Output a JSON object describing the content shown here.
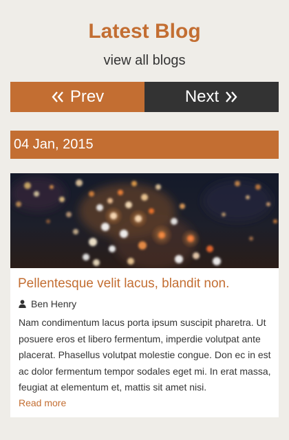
{
  "header": {
    "title": "Latest Blog",
    "subtitle": "view all blogs"
  },
  "nav": {
    "prev_label": "Prev",
    "next_label": "Next",
    "prev_icon": "double-chevron-left-icon",
    "next_icon": "double-chevron-right-icon"
  },
  "post": {
    "date": "04 Jan, 2015",
    "image": "blurred-city-traffic-night-photo",
    "title": "Pellentesque velit lacus, blandit non.",
    "author_icon": "user-icon",
    "author": "Ben Henry",
    "excerpt": "Nam condimentum lacus porta ipsum suscipit pharetra. Ut posuere eros et libero fermentum, imperdie volutpat ante placerat. Phasellus volutpat molestie congue. Don ec in est ac dolor fermentum tempor sodales eget mi. In erat massa, feugiat at elementum et, mattis sit amet nisi.",
    "read_more": "Read more"
  },
  "colors": {
    "accent": "#c36e32",
    "dark": "#333333",
    "background": "#efede8"
  }
}
